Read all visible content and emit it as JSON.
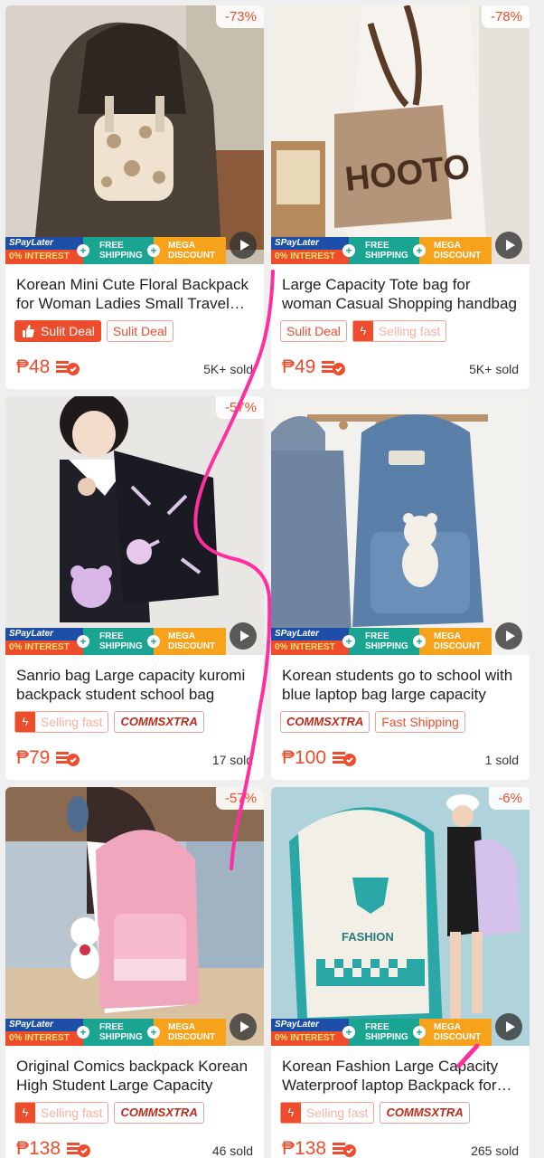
{
  "products": [
    {
      "discount": "-73%",
      "title": "Korean Mini Cute Floral Backpack for Woman Ladies Small Travel Bag",
      "price": "₱48",
      "sold": "5K+ sold",
      "tags": [
        {
          "kind": "solid",
          "label": "Sulit Deal"
        },
        {
          "kind": "outline",
          "label": "Sulit Deal"
        }
      ]
    },
    {
      "discount": "-78%",
      "title": "Large Capacity Tote bag for woman Casual Shopping handbag",
      "price": "₱49",
      "sold": "5K+ sold",
      "tags": [
        {
          "kind": "outline",
          "label": "Sulit Deal"
        },
        {
          "kind": "fast",
          "label": "Selling fast"
        }
      ]
    },
    {
      "discount": "-57%",
      "title": "Sanrio bag Large capacity kuromi backpack student school bag",
      "price": "₱79",
      "sold": "17 sold",
      "tags": [
        {
          "kind": "fast",
          "label": "Selling fast"
        },
        {
          "kind": "comms",
          "label": "COMMSXTRA"
        }
      ]
    },
    {
      "discount": "",
      "title": "Korean students go to school with blue laptop bag large capacity",
      "price": "₱100",
      "sold": "1 sold",
      "tags": [
        {
          "kind": "comms",
          "label": "COMMSXTRA"
        },
        {
          "kind": "outline",
          "label": "Fast Shipping"
        }
      ]
    },
    {
      "discount": "-57%",
      "title": "Original Comics backpack Korean High Student Large Capacity",
      "price": "₱138",
      "sold": "46 sold",
      "tags": [
        {
          "kind": "fast",
          "label": "Selling fast"
        },
        {
          "kind": "comms",
          "label": "COMMSXTRA"
        }
      ]
    },
    {
      "discount": "-6%",
      "title": "Korean Fashion Large Capacity Waterproof laptop Backpack for students",
      "price": "₱138",
      "sold": "265 sold",
      "tags": [
        {
          "kind": "fast",
          "label": "Selling fast"
        },
        {
          "kind": "comms",
          "label": "COMMSXTRA"
        }
      ]
    }
  ],
  "promo_banner": {
    "spaylater": "SPayLater",
    "interest": "0% INTEREST",
    "shipping_top": "FREE",
    "shipping_bottom": "SHIPPING",
    "mega_top": "MEGA",
    "mega_bottom": "DISCOUNT"
  },
  "image_text": {
    "tote_print": "HOOTO",
    "backpack_label": "FASHION"
  },
  "colors": {
    "accent": "#ee4d2d",
    "annotation_stroke": "#ff2fa0"
  },
  "icons": {
    "play": "play-video-icon",
    "coin": "coins-cashback-icon",
    "bolt": "lightning-bolt-icon",
    "thumb": "thumbs-up-icon"
  }
}
